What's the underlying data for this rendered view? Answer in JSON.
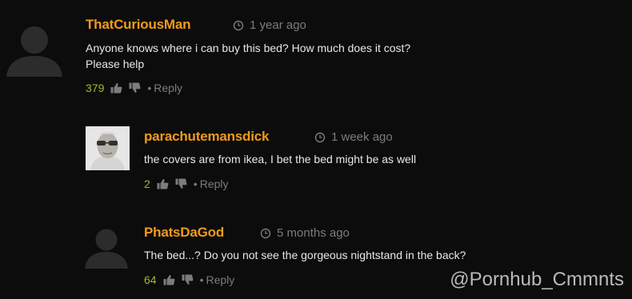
{
  "comments": [
    {
      "username": "ThatCuriousMan",
      "time": "1 year ago",
      "text_lines": [
        "Anyone knows where i can buy this bed? How much does it cost?",
        "Please help"
      ],
      "votes": "379",
      "reply_label": "Reply",
      "avatar": "default-avatar"
    },
    {
      "username": "parachutemansdick",
      "time": "1 week ago",
      "text_lines": [
        "the covers are from ikea, I bet the bed might be as well"
      ],
      "votes": "2",
      "reply_label": "Reply",
      "avatar": "photo-avatar"
    },
    {
      "username": "PhatsDaGod",
      "time": "5 months ago",
      "text_lines": [
        "The bed...? Do you not see the gorgeous nightstand in the back?"
      ],
      "votes": "64",
      "reply_label": "Reply",
      "avatar": "default-avatar"
    }
  ],
  "watermark": "@Pornhub_Cmmnts",
  "icons": {
    "clock": "clock-icon",
    "thumbs_up": "thumbs-up-icon",
    "thumbs_down": "thumbs-down-icon"
  },
  "colors": {
    "background": "#0c0c0c",
    "username": "#f29a1a",
    "vote_count": "#9bbd2b",
    "meta": "#7c7c7c"
  }
}
